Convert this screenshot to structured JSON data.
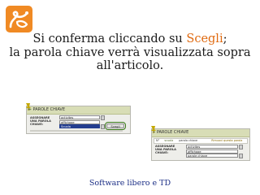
{
  "caption": {
    "line1_before": "Si conferma cliccando su ",
    "line1_highlight": "Scegli",
    "line1_after": ";",
    "line2": "la parola chiave verrà visualizzata sopra",
    "line3": "all'articolo."
  },
  "screenshot1": {
    "header": "PAROLE CHIAVE",
    "field_label": "ASSEGNARE UNA PAROLA CHIAVE:",
    "options": [
      "activites",
      "affichage",
      "Scuola"
    ],
    "selected_option": "Scuola",
    "button_label": "Scegli"
  },
  "screenshot2": {
    "header": "PAROLE CHIAVE",
    "row_no": "N°",
    "row_keyword_group": "scuola",
    "row_keyword_label": "parola chiave",
    "row_action": "Rimuovi questa parola",
    "field_label": "ASSEGNARE UNA PAROLA CHIAVE:",
    "options": [
      "activites",
      "affichage",
      "parole chiave"
    ]
  },
  "footer": {
    "text": "Software libero e TD"
  },
  "colors": {
    "logo": "#f08a24",
    "highlight": "#e06a10",
    "footer": "#1c2f86"
  }
}
